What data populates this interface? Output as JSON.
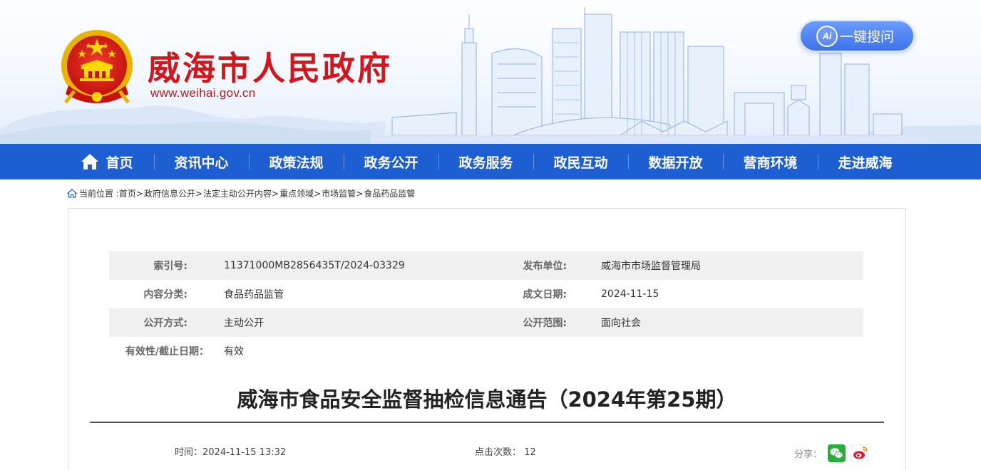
{
  "header": {
    "site_title": "威海市人民政府",
    "site_url": "www.weihai.gov.cn",
    "ai_search": {
      "badge": "Ai",
      "label": "一键搜问"
    },
    "colors": {
      "title_red": "#d4151b",
      "nav_blue": "#1d5fd2"
    }
  },
  "nav": {
    "items": [
      "首页",
      "资讯中心",
      "政策法规",
      "政务公开",
      "政务服务",
      "政民互动",
      "数据开放",
      "营商环境",
      "走进威海"
    ]
  },
  "breadcrumb": {
    "prefix": "当前位置 :",
    "items": [
      "首页",
      "政府信息公开",
      "法定主动公开内容",
      "重点领域",
      "市场监管",
      "食品药品监管"
    ],
    "separator": ">"
  },
  "meta": {
    "index_label": "索引号:",
    "index_value": "11371000MB2856435T/2024-03329",
    "publisher_label": "发布单位:",
    "publisher_value": "威海市市场监督管理局",
    "category_label": "内容分类:",
    "category_value": "食品药品监管",
    "date_label": "成文日期:",
    "date_value": "2024-11-15",
    "mode_label": "公开方式:",
    "mode_value": "主动公开",
    "scope_label": "公开范围:",
    "scope_value": "面向社会",
    "validity_label": "有效性/截止日期：",
    "validity_value": "有效"
  },
  "article": {
    "title": "威海市食品安全监督抽检信息通告（2024年第25期）",
    "time_label": "时间：",
    "time_value": "2024-11-15 13:32",
    "hits_label": "点击次数：",
    "hits_value": "12",
    "share_label": "分享："
  },
  "icons": [
    "national-emblem-icon",
    "home-icon",
    "wechat-icon",
    "weibo-icon"
  ]
}
